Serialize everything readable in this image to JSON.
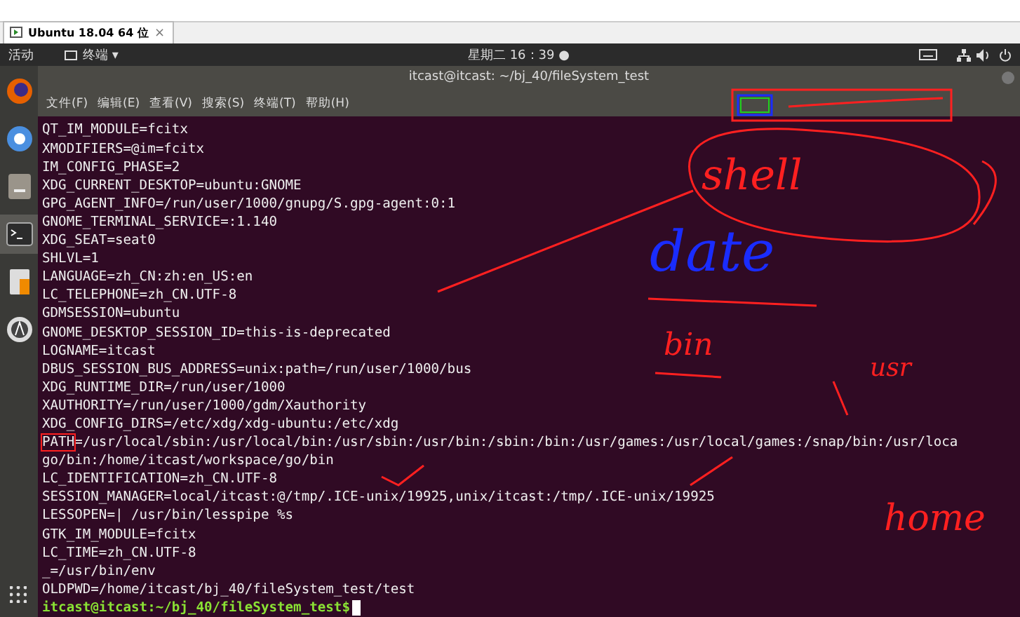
{
  "browser_tab": {
    "label": "Ubuntu 18.04 64 位",
    "close": "×",
    "selected": true
  },
  "top_bar": {
    "activities": "活动",
    "app_menu": "终端",
    "app_menu_caret": "▾",
    "clock": "星期二 16：39",
    "clock_dot": "●"
  },
  "dock": {
    "items": [
      {
        "kind": "firefox",
        "selected": false
      },
      {
        "kind": "chromium",
        "selected": false
      },
      {
        "kind": "files",
        "selected": false
      },
      {
        "kind": "terminal",
        "selected": true
      },
      {
        "kind": "office",
        "selected": false
      },
      {
        "kind": "software",
        "selected": false
      }
    ]
  },
  "terminal": {
    "title": "itcast@itcast: ~/bj_40/fileSystem_test",
    "menu": [
      "文件(F)",
      "编辑(E)",
      "查看(V)",
      "搜索(S)",
      "终端(T)",
      "帮助(H)"
    ],
    "lines": [
      "QT_IM_MODULE=fcitx",
      "XMODIFIERS=@im=fcitx",
      "IM_CONFIG_PHASE=2",
      "XDG_CURRENT_DESKTOP=ubuntu:GNOME",
      "GPG_AGENT_INFO=/run/user/1000/gnupg/S.gpg-agent:0:1",
      "GNOME_TERMINAL_SERVICE=:1.140",
      "XDG_SEAT=seat0",
      "SHLVL=1",
      "LANGUAGE=zh_CN:zh:en_US:en",
      "LC_TELEPHONE=zh_CN.UTF-8",
      "GDMSESSION=ubuntu",
      "GNOME_DESKTOP_SESSION_ID=this-is-deprecated",
      "LOGNAME=itcast",
      "DBUS_SESSION_BUS_ADDRESS=unix:path=/run/user/1000/bus",
      "XDG_RUNTIME_DIR=/run/user/1000",
      "XAUTHORITY=/run/user/1000/gdm/Xauthority",
      "XDG_CONFIG_DIRS=/etc/xdg/xdg-ubuntu:/etc/xdg",
      "PATH=/usr/local/sbin:/usr/local/bin:/usr/sbin:/usr/bin:/sbin:/bin:/usr/games:/usr/local/games:/snap/bin:/usr/loca",
      "go/bin:/home/itcast/workspace/go/bin",
      "LC_IDENTIFICATION=zh_CN.UTF-8",
      "SESSION_MANAGER=local/itcast:@/tmp/.ICE-unix/19925,unix/itcast:/tmp/.ICE-unix/19925",
      "LESSOPEN=| /usr/bin/lesspipe %s",
      "GTK_IM_MODULE=fcitx",
      "LC_TIME=zh_CN.UTF-8",
      "_=/usr/bin/env",
      "OLDPWD=/home/itcast/bj_40/fileSystem_test/test"
    ],
    "prompt": "itcast@itcast:~/bj_40/fileSystem_test$"
  },
  "annotations": [
    {
      "kind": "red",
      "text": "shell"
    },
    {
      "kind": "blue",
      "text": "date"
    },
    {
      "kind": "red",
      "text": "bin"
    },
    {
      "kind": "red",
      "text": "usr"
    },
    {
      "kind": "red",
      "text": "home"
    }
  ]
}
